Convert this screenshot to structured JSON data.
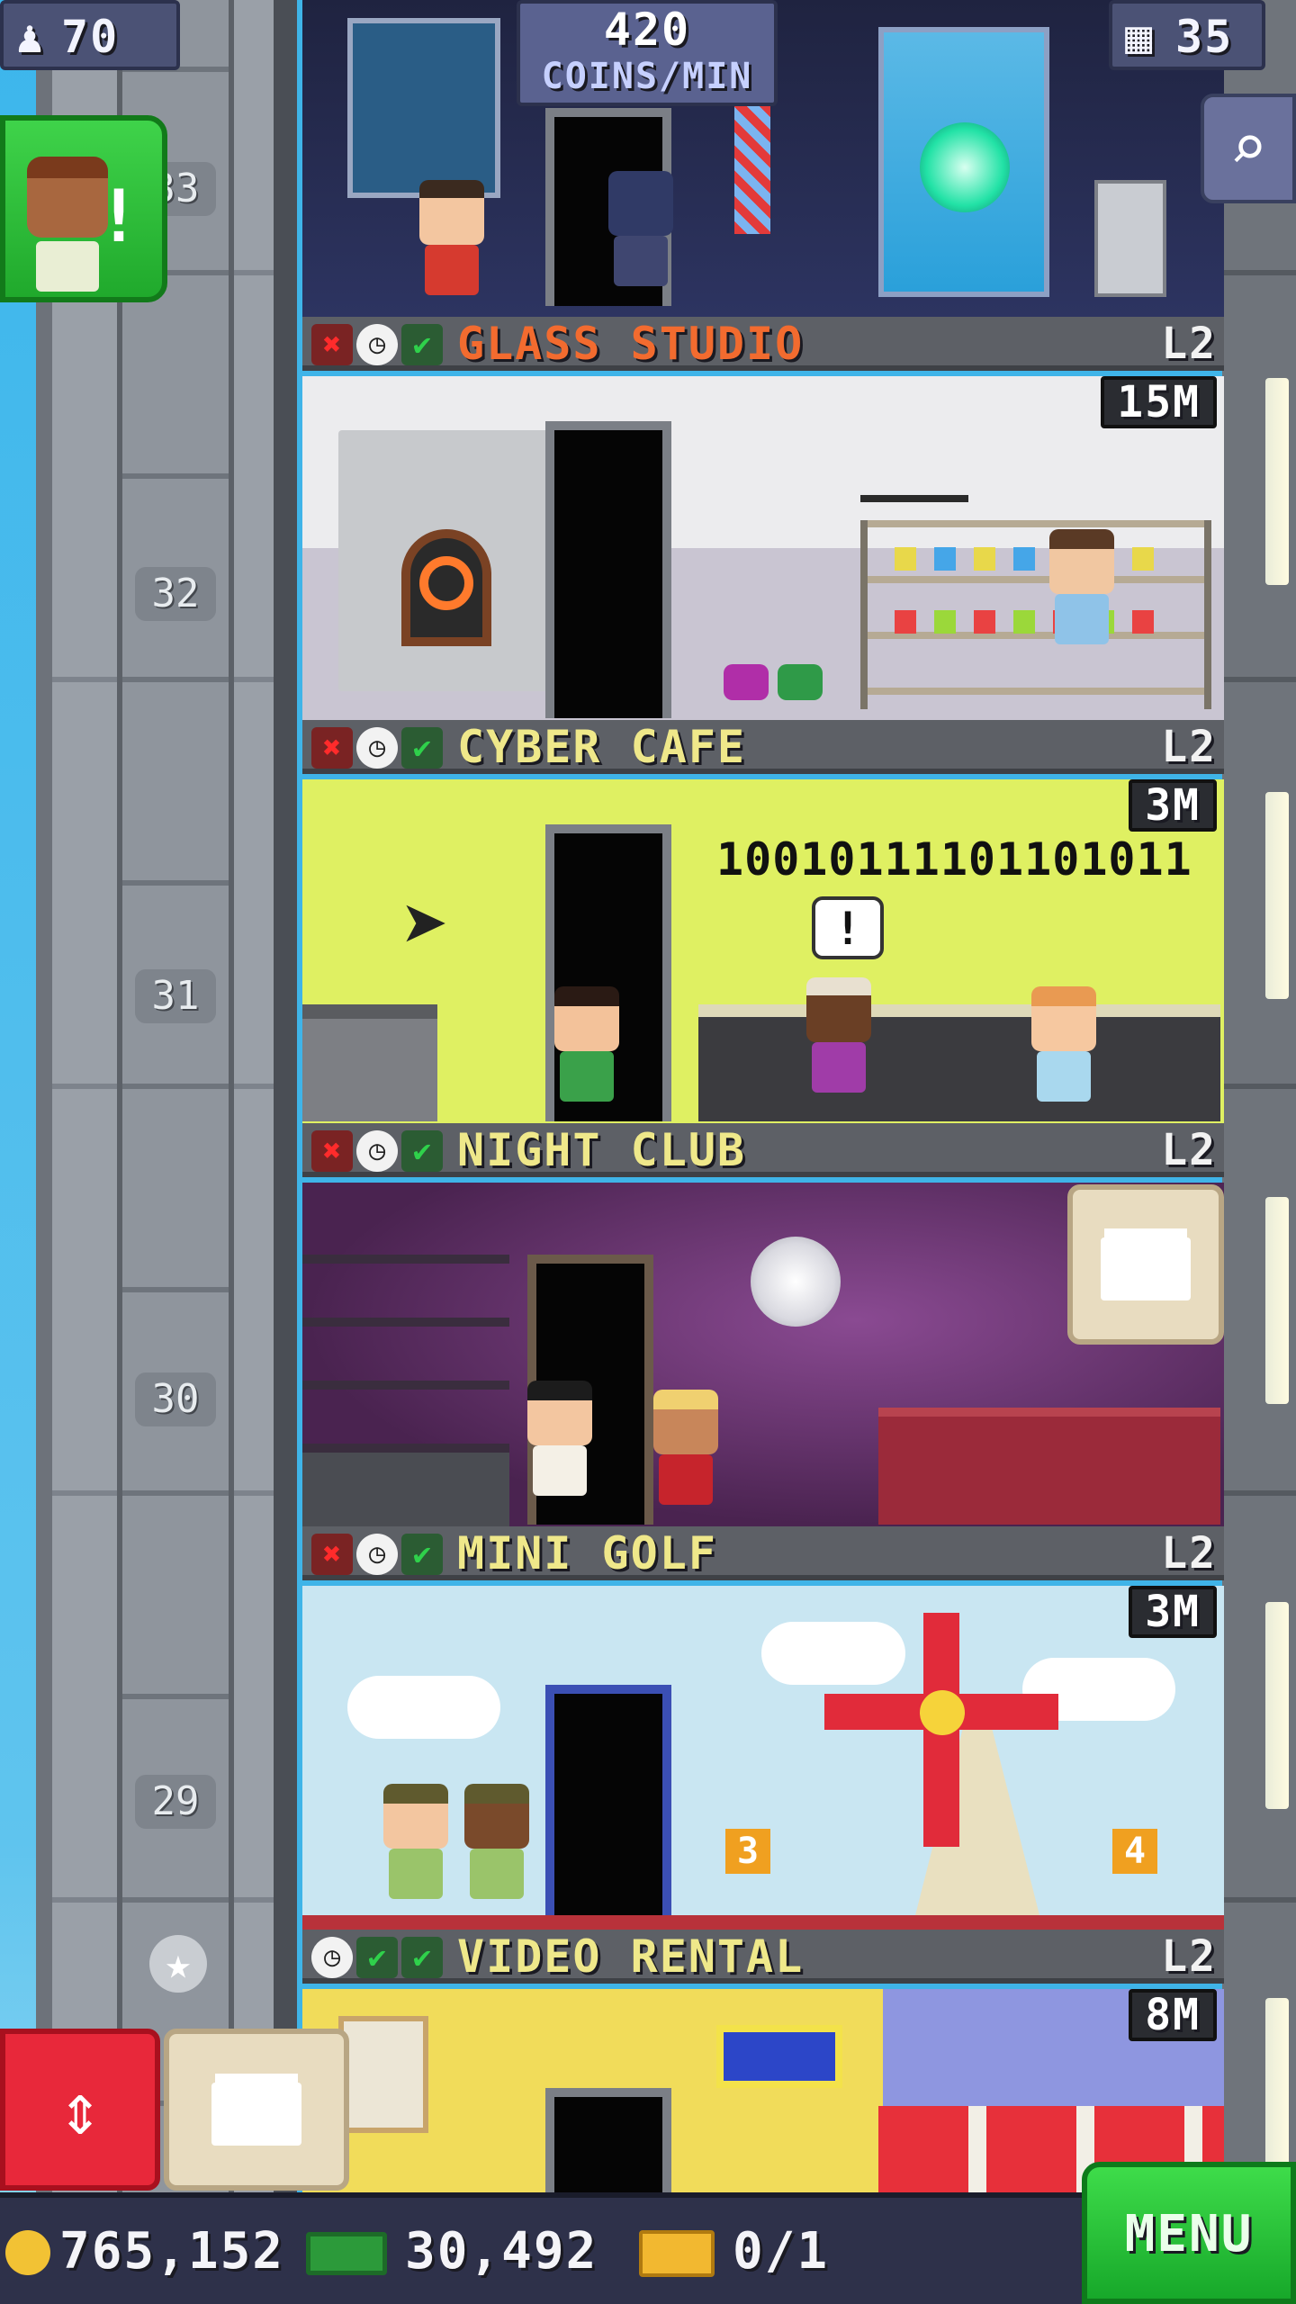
{
  "hud": {
    "population": "70",
    "coins_per_min_value": "420",
    "coins_per_min_label": "COINS/MIN",
    "floors_count": "35"
  },
  "floors": [
    {
      "number": "33",
      "name": "",
      "level": "",
      "timer": ""
    },
    {
      "number": "32",
      "name": "GLASS STUDIO",
      "level": "L2",
      "timer": "15M"
    },
    {
      "number": "31",
      "name": "CYBER CAFE",
      "level": "L2",
      "timer": "3M",
      "binary_text": "10010111101101011"
    },
    {
      "number": "30",
      "name": "NIGHT CLUB",
      "level": "L2",
      "timer": ""
    },
    {
      "number": "29",
      "name": "MINI GOLF",
      "level": "L2",
      "timer": "3M",
      "hole_a": "3",
      "hole_b": "4"
    },
    {
      "number": "",
      "name": "VIDEO RENTAL",
      "level": "L2",
      "timer": "8M"
    }
  ],
  "bottom_bar": {
    "coins": "765,152",
    "bux": "30,492",
    "tickets": "0/1",
    "menu_label": "MENU"
  },
  "icons": {
    "population": "person-icon",
    "floors": "building-icon",
    "zoom": "magnifier-icon",
    "coins": "coin-icon",
    "bux": "bux-icon",
    "tickets": "ticket-icon",
    "elevator": "up-down-arrow-icon",
    "stock": "box-icon"
  },
  "colors": {
    "glass_studio_title": "#f26b2f",
    "other_titles": "#efe88a",
    "menu_green": "#2bc93a",
    "elevator_red": "#e8283a"
  }
}
